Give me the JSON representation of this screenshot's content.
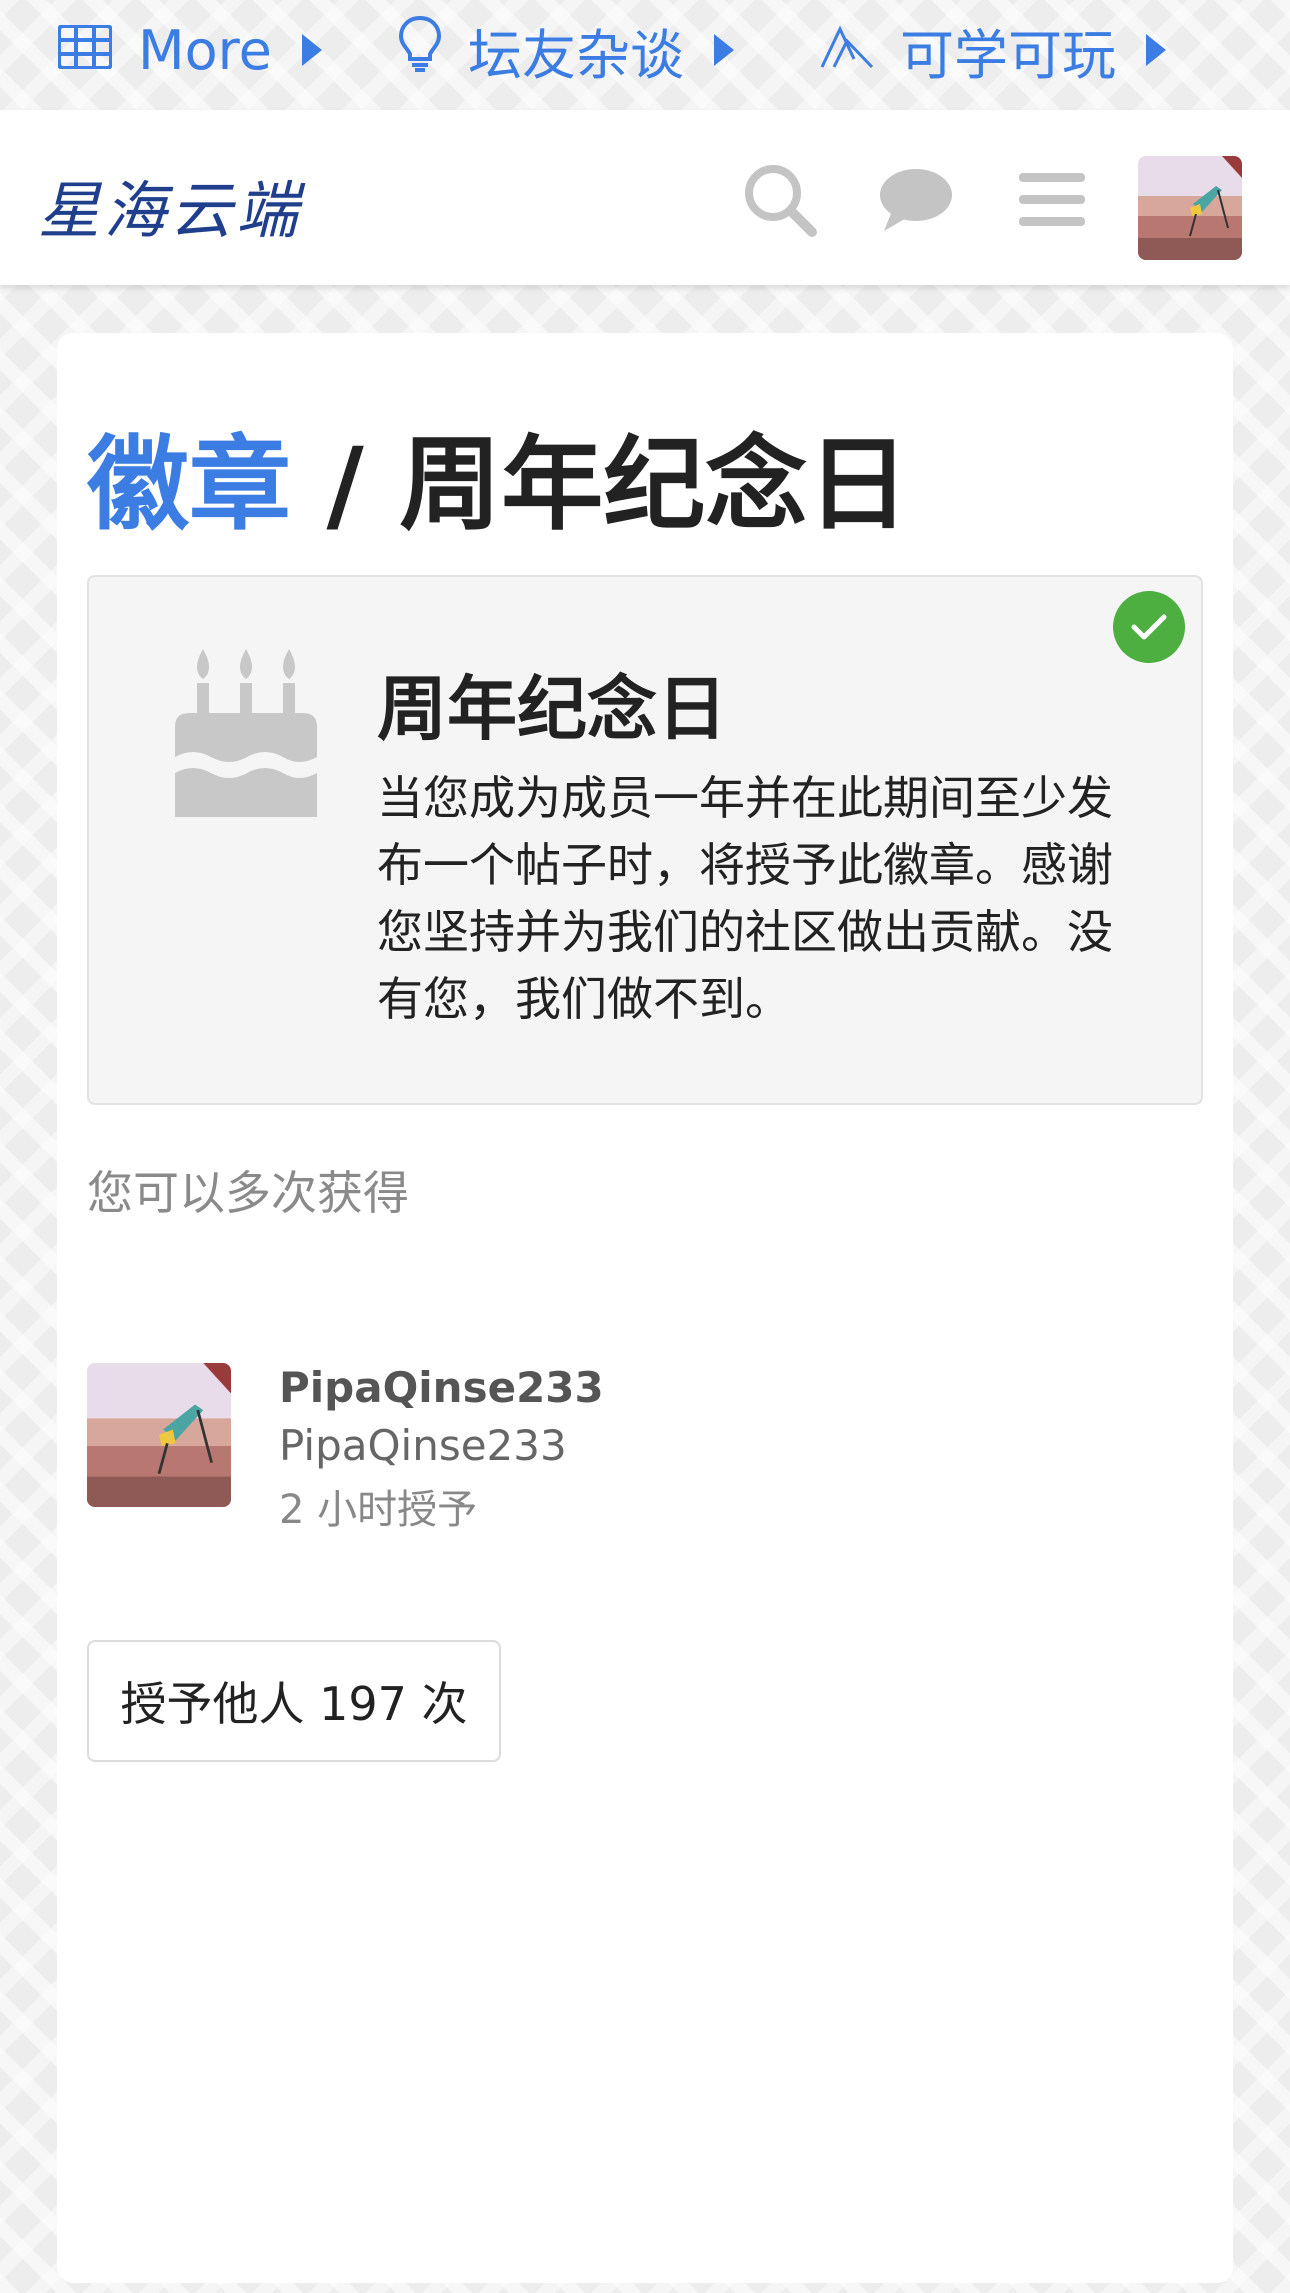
{
  "top_nav": {
    "items": [
      {
        "label": "More",
        "icon": "grid-icon"
      },
      {
        "label": "坛友杂谈",
        "icon": "lightbulb-icon"
      },
      {
        "label": "可学可玩",
        "icon": "peak-icon"
      }
    ],
    "accent": "#3b7de3"
  },
  "header": {
    "logo_text": "星海云端",
    "icons": [
      "search-icon",
      "chat-bubble-icon",
      "hamburger-menu-icon",
      "user-avatar"
    ]
  },
  "page": {
    "breadcrumb_parent": "徽章",
    "separator": " / ",
    "title": "周年纪念日"
  },
  "badge": {
    "name": "周年纪念日",
    "description": "当您成为成员一年并在此期间至少发布一个帖子时，将授予此徽章。感谢您坚持并为我们的社区做出贡献。没有您，我们做不到。",
    "icon": "birthday-cake-icon",
    "earned": true,
    "earned_color": "#4caf3f"
  },
  "multi_grant_note": "您可以多次获得",
  "recent_grant": {
    "username": "PipaQinse233",
    "display_name": "PipaQinse233",
    "time": "2 小时授予"
  },
  "granted_count_button": "授予他人 197 次"
}
